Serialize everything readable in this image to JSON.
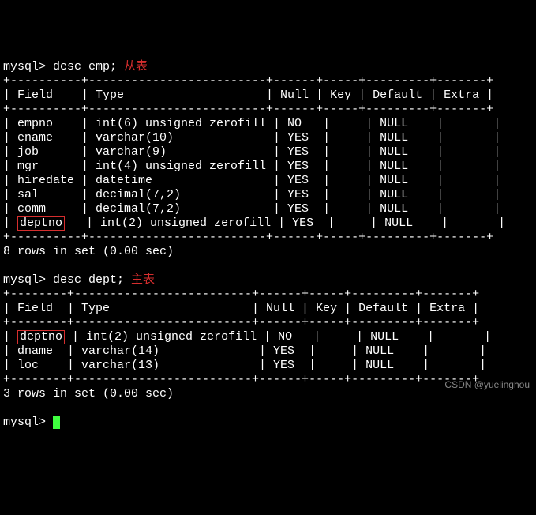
{
  "prompt": "mysql> ",
  "commands": {
    "cmd1": "desc emp;",
    "cmd2": "desc dept;"
  },
  "annotations": {
    "anno1": "从表",
    "anno2": "主表"
  },
  "sep": {
    "emp": "+----------+-------------------------+------+-----+---------+-------+",
    "dept": "+--------+-------------------------+------+-----+---------+-------+"
  },
  "headers": {
    "emp": "| Field    | Type                    | Null | Key | Default | Extra |",
    "dept": "| Field  | Type                    | Null | Key | Default | Extra |"
  },
  "emp_rows": [
    {
      "field": "empno",
      "rest": "| int(6) unsigned zerofill | NO   |     | NULL    |       |"
    },
    {
      "field": "ename",
      "rest": "| varchar(10)              | YES  |     | NULL    |       |"
    },
    {
      "field": "job",
      "rest": "| varchar(9)               | YES  |     | NULL    |       |"
    },
    {
      "field": "mgr",
      "rest": "| int(4) unsigned zerofill | YES  |     | NULL    |       |"
    },
    {
      "field": "hiredate",
      "rest": "| datetime                 | YES  |     | NULL    |       |"
    },
    {
      "field": "sal",
      "rest": "| decimal(7,2)             | YES  |     | NULL    |       |"
    },
    {
      "field": "comm",
      "rest": "| decimal(7,2)             | YES  |     | NULL    |       |"
    },
    {
      "field": "deptno",
      "rest": "| int(2) unsigned zerofill | YES  |     | NULL    |       |"
    }
  ],
  "dept_rows": [
    {
      "field": "deptno",
      "rest": "| int(2) unsigned zerofill | NO   |     | NULL    |       |"
    },
    {
      "field": "dname",
      "rest": "| varchar(14)              | YES  |     | NULL    |       |"
    },
    {
      "field": "loc",
      "rest": "| varchar(13)              | YES  |     | NULL    |       |"
    }
  ],
  "footers": {
    "emp": "8 rows in set (0.00 sec)",
    "dept": "3 rows in set (0.00 sec)"
  },
  "watermark": "CSDN @yuelinghou",
  "chart_data": {
    "type": "table",
    "tables": [
      {
        "name": "emp",
        "columns": [
          "Field",
          "Type",
          "Null",
          "Key",
          "Default",
          "Extra"
        ],
        "rows": [
          [
            "empno",
            "int(6) unsigned zerofill",
            "NO",
            "",
            "NULL",
            ""
          ],
          [
            "ename",
            "varchar(10)",
            "YES",
            "",
            "NULL",
            ""
          ],
          [
            "job",
            "varchar(9)",
            "YES",
            "",
            "NULL",
            ""
          ],
          [
            "mgr",
            "int(4) unsigned zerofill",
            "YES",
            "",
            "NULL",
            ""
          ],
          [
            "hiredate",
            "datetime",
            "YES",
            "",
            "NULL",
            ""
          ],
          [
            "sal",
            "decimal(7,2)",
            "YES",
            "",
            "NULL",
            ""
          ],
          [
            "comm",
            "decimal(7,2)",
            "YES",
            "",
            "NULL",
            ""
          ],
          [
            "deptno",
            "int(2) unsigned zerofill",
            "YES",
            "",
            "NULL",
            ""
          ]
        ]
      },
      {
        "name": "dept",
        "columns": [
          "Field",
          "Type",
          "Null",
          "Key",
          "Default",
          "Extra"
        ],
        "rows": [
          [
            "deptno",
            "int(2) unsigned zerofill",
            "NO",
            "",
            "NULL",
            ""
          ],
          [
            "dname",
            "varchar(14)",
            "YES",
            "",
            "NULL",
            ""
          ],
          [
            "loc",
            "varchar(13)",
            "YES",
            "",
            "NULL",
            ""
          ]
        ]
      }
    ]
  }
}
